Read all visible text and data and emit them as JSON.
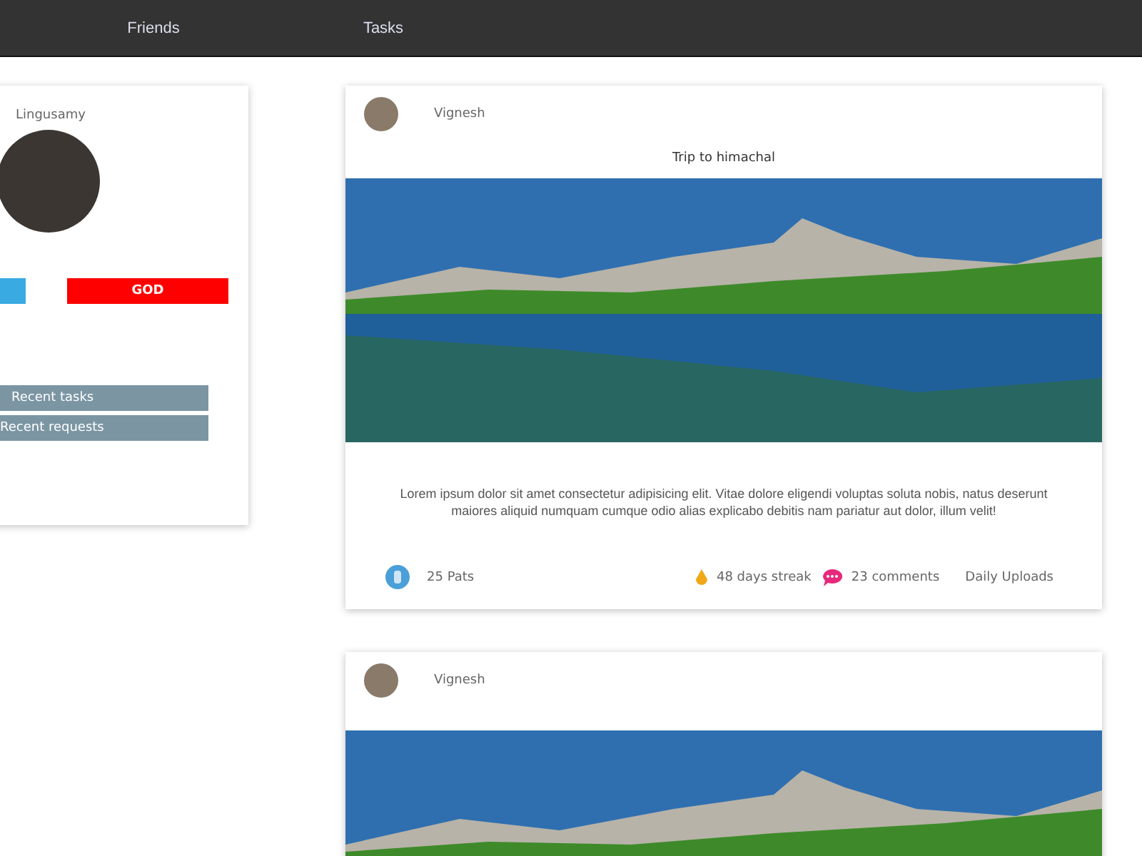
{
  "nav": [
    {
      "label": "Friends"
    },
    {
      "label": "Tasks"
    }
  ],
  "profile": {
    "name": "Lingusamy",
    "badges": [
      {
        "color": "#3aabe2"
      },
      {
        "label": "GOD",
        "color": "#ff0000"
      }
    ],
    "links": [
      {
        "label": "Recent tasks"
      },
      {
        "label": "Recent requests"
      }
    ]
  },
  "posts": [
    {
      "author": "Vignesh",
      "title": "Trip to himachal",
      "body": "Lorem ipsum dolor sit amet consectetur adipisicing elit. Vitae dolore eligendi voluptas soluta nobis, natus deserunt maiores aliquid numquam cumque odio alias explicabo debitis nam pariatur aut dolor, illum velit!",
      "pats": "25 Pats",
      "streak": "48 days streak",
      "comments": "23 comments",
      "category": "Daily Uploads"
    },
    {
      "author": "Vignesh"
    }
  ]
}
